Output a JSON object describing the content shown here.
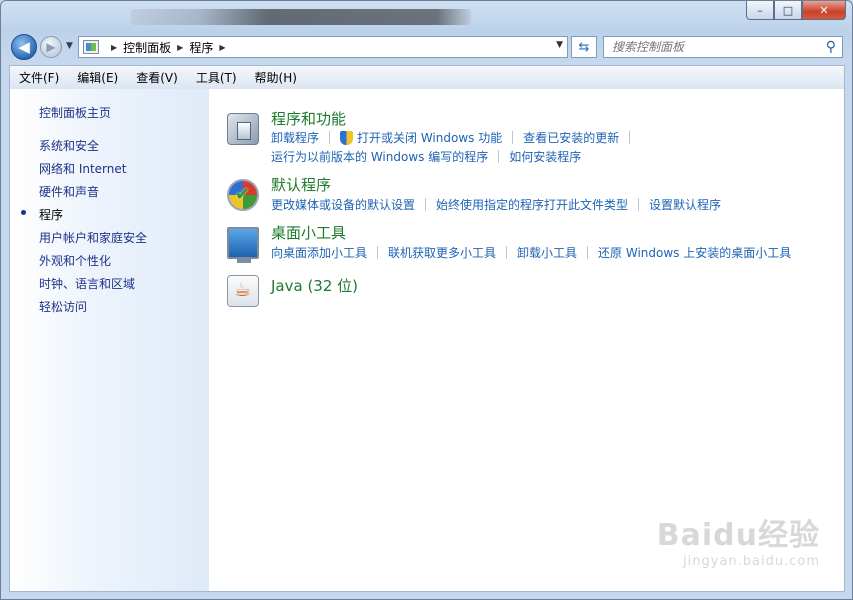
{
  "window": {
    "caption_buttons": [
      "–",
      "□",
      "✕"
    ]
  },
  "navigation": {
    "back_glyph": "◀",
    "forward_glyph": "▶",
    "breadcrumbs": [
      "控制面板",
      "程序"
    ],
    "search_placeholder": "搜索控制面板"
  },
  "menu": [
    "文件(F)",
    "编辑(E)",
    "查看(V)",
    "工具(T)",
    "帮助(H)"
  ],
  "sidebar": {
    "items": [
      {
        "label": "控制面板主页"
      },
      {
        "label": "系统和安全"
      },
      {
        "label": "网络和 Internet"
      },
      {
        "label": "硬件和声音"
      },
      {
        "label": "程序",
        "selected": true
      },
      {
        "label": "用户帐户和家庭安全"
      },
      {
        "label": "外观和个性化"
      },
      {
        "label": "时钟、语言和区域"
      },
      {
        "label": "轻松访问"
      }
    ]
  },
  "categories": [
    {
      "title": "程序和功能",
      "icon": "programs-icon",
      "row1": [
        "卸载程序",
        "打开或关闭 Windows 功能",
        "查看已安装的更新"
      ],
      "row2": [
        "运行为以前版本的 Windows 编写的程序",
        "如何安装程序"
      ]
    },
    {
      "title": "默认程序",
      "icon": "default-programs-icon",
      "row1": [
        "更改媒体或设备的默认设置",
        "始终使用指定的程序打开此文件类型",
        "设置默认程序"
      ]
    },
    {
      "title": "桌面小工具",
      "icon": "desktop-gadgets-icon",
      "row1": [
        "向桌面添加小工具",
        "联机获取更多小工具",
        "卸载小工具",
        "还原 Windows 上安装的桌面小工具"
      ]
    },
    {
      "title": "Java (32 位)",
      "icon": "java-icon"
    }
  ],
  "watermark": {
    "brand": "Baidu经验",
    "url": "jingyan.baidu.com"
  }
}
